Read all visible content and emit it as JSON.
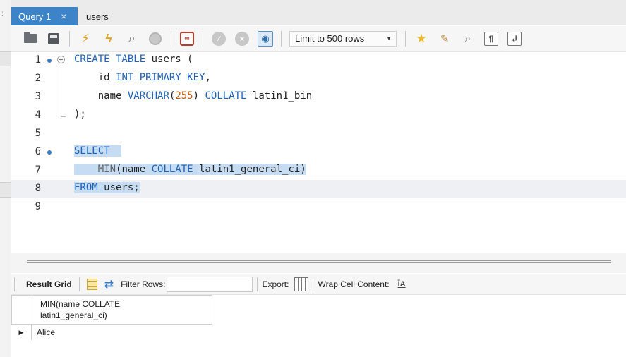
{
  "tabs": [
    {
      "label": "Query 1",
      "close": "×",
      "active": true
    },
    {
      "label": "users",
      "active": false
    }
  ],
  "toolbar": {
    "icons": [
      "open-folder-icon",
      "save-icon",
      "execute-icon",
      "execute-current-icon",
      "explain-icon",
      "stop-icon",
      "toggle-error-icon",
      "commit-icon",
      "rollback-icon",
      "autocommit-icon",
      "bookmark-icon",
      "beautify-icon",
      "find-icon",
      "invisible-chars-icon",
      "wrap-icon"
    ],
    "limit_label": "Limit to 500 rows",
    "stop_glyph": "∞"
  },
  "editor": {
    "lines": [
      {
        "n": "1"
      },
      {
        "n": "2"
      },
      {
        "n": "3"
      },
      {
        "n": "4"
      },
      {
        "n": "5"
      },
      {
        "n": "6"
      },
      {
        "n": "7"
      },
      {
        "n": "8"
      },
      {
        "n": "9"
      }
    ],
    "code": {
      "l1_kw": "CREATE TABLE",
      "l1_rest": " users (",
      "l2_indent": "    ",
      "l2_id": "id ",
      "l2_kw": "INT PRIMARY KEY",
      "l2_comma": ",",
      "l3_indent": "    ",
      "l3_name": "name ",
      "l3_kw1": "VARCHAR",
      "l3_paren_open": "(",
      "l3_num": "255",
      "l3_paren_close": ") ",
      "l3_kw2": "COLLATE",
      "l3_rest": " latin1_bin",
      "l4": ");",
      "l6_kw": "SELECT",
      "l6_pad": "  ",
      "l7_indent": "    ",
      "l7_fn": "MIN",
      "l7_open": "(name ",
      "l7_kw": "COLLATE",
      "l7_rest": " latin1_general_ci)",
      "l8_kw": "FROM",
      "l8_rest": " users;"
    }
  },
  "result_toolbar": {
    "result_grid_label": "Result Grid",
    "filter_label": "Filter Rows:",
    "filter_value": "",
    "export_label": "Export:",
    "wrap_label": "Wrap Cell Content:",
    "wrap_icon_text": "ĪA"
  },
  "result_grid": {
    "column_header_line1": "MIN(name COLLATE",
    "column_header_line2": "latin1_general_ci)",
    "rows": [
      {
        "marker": "▶",
        "value": "Alice"
      }
    ]
  }
}
